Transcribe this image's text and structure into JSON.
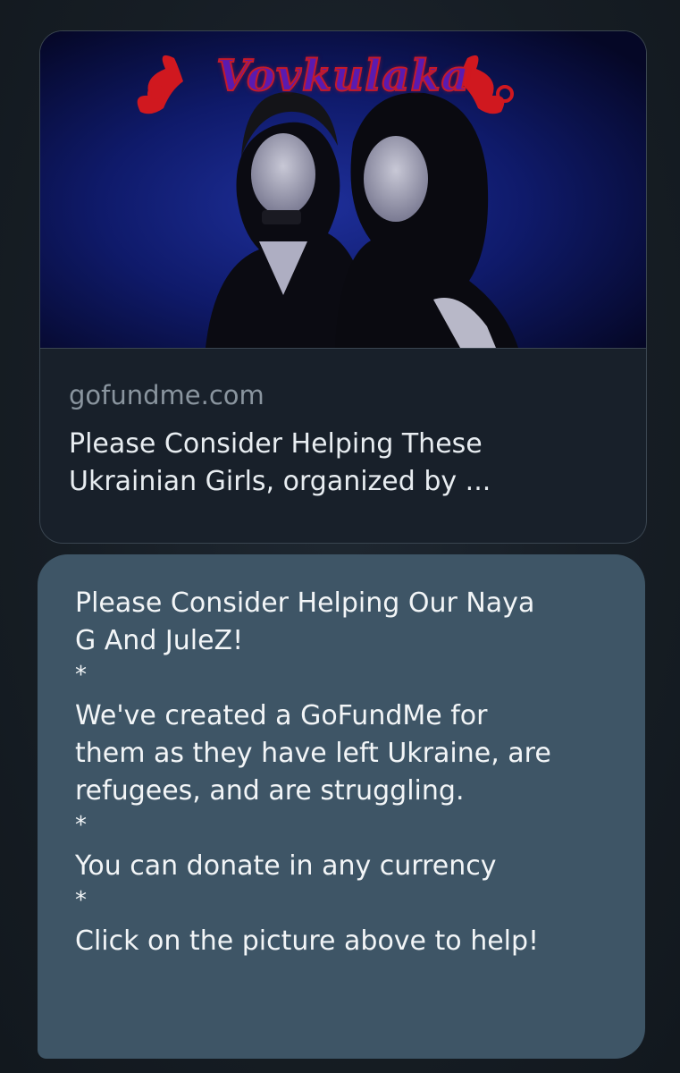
{
  "link_card": {
    "image_logo_text": "Vovkulaka",
    "domain": "gofundme.com",
    "title_line1": "Please Consider Helping These",
    "title_line2": "Ukrainian Girls, organized by ..."
  },
  "message": {
    "lines": [
      "Please Consider Helping Our Naya",
      "G And JuleZ!",
      "*",
      "We've created a GoFundMe for",
      "them as they have left Ukraine, are",
      "refugees, and are struggling.",
      "*",
      "You can donate in any currency",
      "*",
      "Click on the picture above to help!"
    ]
  },
  "colors": {
    "background": "#161d24",
    "bubble": "#3e5566",
    "card_border": "#3a4550",
    "domain_text": "#8a959f",
    "logo_red": "#c31a2a",
    "logo_purple": "#5a1bb0"
  }
}
